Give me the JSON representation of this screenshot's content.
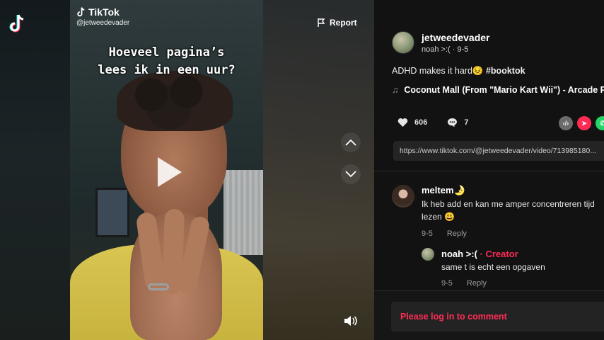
{
  "video": {
    "watermark_brand": "TikTok",
    "watermark_user": "@jetweedevader",
    "caption_line1": "Hoeveel pagina’s",
    "caption_line2": "lees ik in een uur?"
  },
  "controls": {
    "report_label": "Report"
  },
  "post": {
    "author_username": "jetweedevader",
    "author_meta": "noah >:( · 9-5",
    "description": "ADHD makes it hard😣 ",
    "hashtag": "#booktok",
    "music": "Coconut Mall (From \"Mario Kart Wii\") - Arcade Pla",
    "likes": "606",
    "comments": "7",
    "link": "https://www.tiktok.com/@jetweedevader/video/713985180..."
  },
  "comments": [
    {
      "name": "meltem🌛",
      "text_line1": "Ik heb add en kan me amper concentreren tijd",
      "text_line2": "lezen 😃",
      "date": "9-5",
      "reply_label": "Reply"
    },
    {
      "name": "noah >:(",
      "creator_label": " · Creator",
      "text": "same t is echt een opgaven",
      "date": "9-5",
      "reply_label": "Reply"
    }
  ],
  "login_prompt": "Please log in to comment",
  "colors": {
    "accent": "#fe2c55",
    "panel_bg": "#121212",
    "input_bg": "#242424"
  }
}
